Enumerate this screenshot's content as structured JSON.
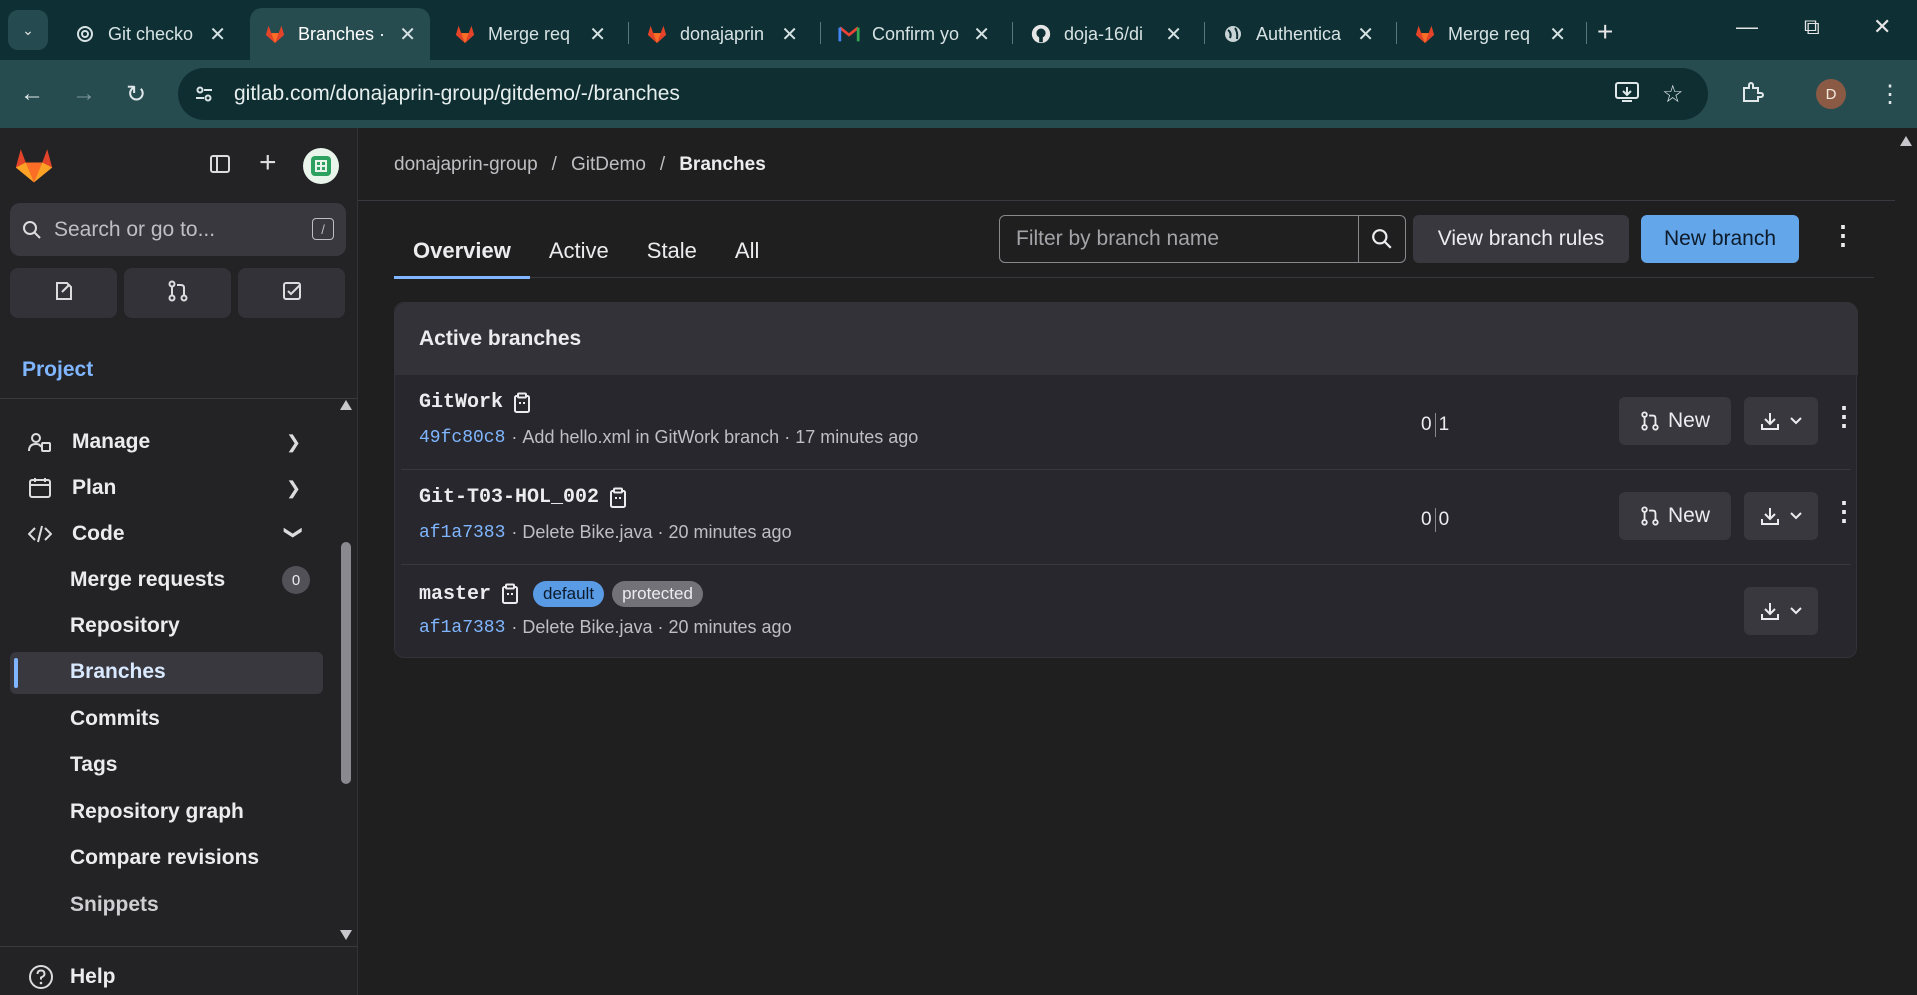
{
  "browser": {
    "tabs": [
      {
        "title": "Git checko",
        "icon": "openai-icon"
      },
      {
        "title": "Branches ·",
        "icon": "gitlab-icon",
        "active": true
      },
      {
        "title": "Merge req",
        "icon": "gitlab-icon"
      },
      {
        "title": "donajaprin",
        "icon": "gitlab-icon"
      },
      {
        "title": "Confirm yo",
        "icon": "gmail-icon"
      },
      {
        "title": "doja-16/di",
        "icon": "github-icon"
      },
      {
        "title": "Authentica",
        "icon": "globe-icon"
      },
      {
        "title": "Merge req",
        "icon": "gitlab-icon"
      }
    ],
    "url": "gitlab.com/donajaprin-group/gitdemo/-/branches",
    "profile_initial": "D"
  },
  "sidebar": {
    "search_placeholder": "Search or go to...",
    "search_shortcut": "/",
    "context_title": "Project",
    "groups": [
      {
        "label": "Manage",
        "icon": "manage-icon",
        "expanded": false
      },
      {
        "label": "Plan",
        "icon": "plan-icon",
        "expanded": false
      },
      {
        "label": "Code",
        "icon": "code-icon",
        "expanded": true
      }
    ],
    "code_items": [
      {
        "label": "Merge requests",
        "badge": "0"
      },
      {
        "label": "Repository"
      },
      {
        "label": "Branches",
        "active": true
      },
      {
        "label": "Commits"
      },
      {
        "label": "Tags"
      },
      {
        "label": "Repository graph"
      },
      {
        "label": "Compare revisions"
      },
      {
        "label": "Snippets"
      }
    ],
    "help_label": "Help"
  },
  "breadcrumb": [
    "donajaprin-group",
    "GitDemo",
    "Branches"
  ],
  "tabs": [
    "Overview",
    "Active",
    "Stale",
    "All"
  ],
  "selected_tab": "Overview",
  "filter_placeholder": "Filter by branch name",
  "buttons": {
    "view_rules": "View branch rules",
    "new_branch": "New branch",
    "new_mr": "New"
  },
  "section_title": "Active branches",
  "branches": [
    {
      "name": "GitWork",
      "sha": "49fc80c8",
      "message": "Add hello.xml in GitWork branch",
      "time": "17 minutes ago",
      "behind": "0",
      "ahead": "1",
      "badges": []
    },
    {
      "name": "Git-T03-HOL_002",
      "sha": "af1a7383",
      "message": "Delete Bike.java",
      "time": "20 minutes ago",
      "behind": "0",
      "ahead": "0",
      "badges": []
    },
    {
      "name": "master",
      "sha": "af1a7383",
      "message": "Delete Bike.java",
      "time": "20 minutes ago",
      "badges": [
        "default",
        "protected"
      ]
    }
  ],
  "colors": {
    "accent": "#7fb6ff",
    "primary_button": "#63a6e9",
    "chrome": "#0e2f33"
  }
}
